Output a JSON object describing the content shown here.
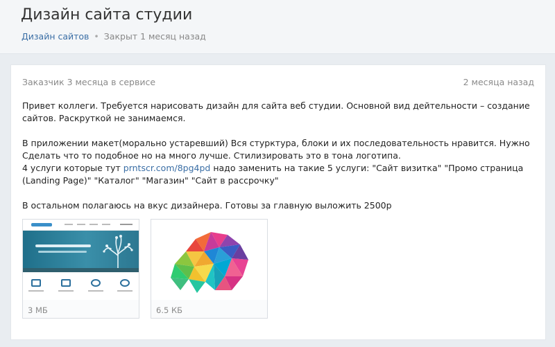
{
  "project": {
    "title": "Дизайн сайта студии",
    "category": "Дизайн сайтов",
    "status": "Закрыт 1 месяц назад"
  },
  "card": {
    "customer": "Заказчик 3 месяца в сервисе",
    "posted": "2 месяца назад",
    "paragraph1": "Привет коллеги. Требуется нарисовать дизайн для сайта веб студии. Основной вид дейтельности – создание сайтов. Раскруткой не занимаемся.",
    "paragraph2": "В приложении макет(морально устаревший) Вся стурктура, блоки и их последовательность нравится. Нужно Сделать что то подобное но на много лучше. Стилизировать это в тона логотипа.",
    "p3_before": "4 услуги которые тут ",
    "p3_link": "prntscr.com/8pg4pd",
    "p3_after": " надо заменить на такие 5 услуги: \"Сайт визитка\" \"Промо страница (Landing Page)\" \"Каталог\" \"Магазин\" \"Сайт в рассрочку\"",
    "paragraph4": "В остальном полагаюсь на вкус дизайнера. Готовы за главную выложить 2500р"
  },
  "attachments": [
    {
      "size": "3 МБ",
      "icon": "website-mockup-thumbnail"
    },
    {
      "size": "6.5 КБ",
      "icon": "colorful-logo-thumbnail"
    }
  ],
  "colors": {
    "link": "#3a6ea5",
    "muted": "#8a8a8a",
    "background": "#e9edf1"
  }
}
